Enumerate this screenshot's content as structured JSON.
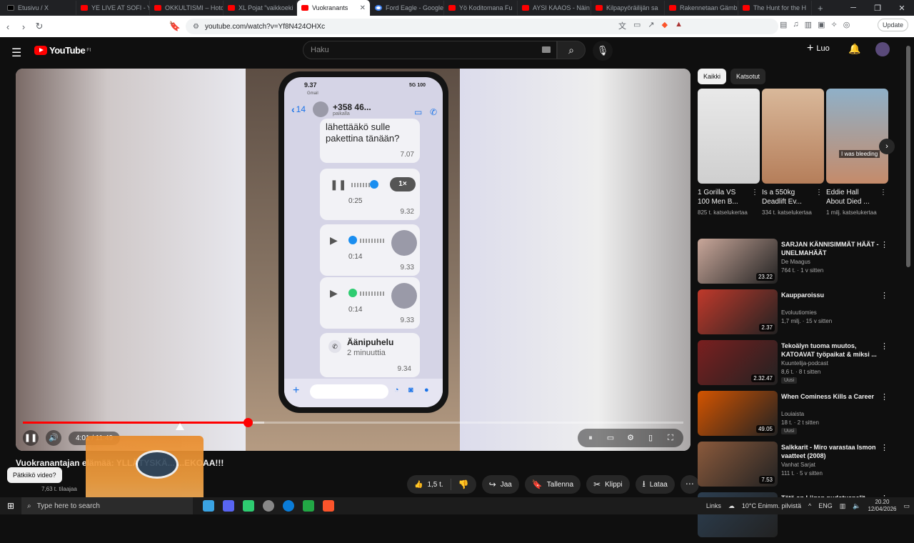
{
  "browser": {
    "tabs": [
      {
        "label": "Etusivu / X",
        "icon": "x-icon"
      },
      {
        "label": "YE LIVE AT SOFI - Yo",
        "icon": "youtube-icon"
      },
      {
        "label": "OKKULTISMI – Hoto",
        "icon": "youtube-icon"
      },
      {
        "label": "XL Pojat \"vaikkoeki",
        "icon": "youtube-icon"
      },
      {
        "label": "Vuokranants",
        "icon": "youtube-icon",
        "active": true
      },
      {
        "label": "Ford Eagle - Google",
        "icon": "google-icon"
      },
      {
        "label": "Yö Koditomana Fu",
        "icon": "youtube-icon"
      },
      {
        "label": "AYSI KAAOS - Näin",
        "icon": "youtube-icon"
      },
      {
        "label": "Kilpapyöräilijän sa",
        "icon": "youtube-icon"
      },
      {
        "label": "Rakennetaan Gämb",
        "icon": "youtube-icon"
      },
      {
        "label": "The Hunt for the H",
        "icon": "youtube-icon"
      }
    ],
    "url": "youtube.com/watch?v=Yf8N424OHXc",
    "update_label": "Update"
  },
  "youtube": {
    "logo_text": "YouTube",
    "region": "FI",
    "search_placeholder": "Haku",
    "create_label": "Luo"
  },
  "player": {
    "current_time": "4:01",
    "duration": "11:49",
    "time_display": "4:01 / 11:49",
    "progress": 0.34,
    "loaded": 0.365
  },
  "phone_screen": {
    "time": "9.37",
    "network": "5G",
    "battery": "100",
    "back_label": "Gmail",
    "back_count": "14",
    "contact": "+358 46...",
    "contact_status": "paikalla",
    "messages": [
      {
        "type": "text",
        "text": "lähettääkö sulle pakettina tänään?",
        "time": "7.07"
      },
      {
        "type": "voice",
        "duration": "0:25",
        "time": "9.32",
        "speed": "1×"
      },
      {
        "type": "voice",
        "duration": "0:14",
        "time": "9.33"
      },
      {
        "type": "voice",
        "duration": "0:14",
        "time": "9.33"
      },
      {
        "type": "call",
        "title": "Äänipuhelu",
        "subtitle": "2 minuuttia",
        "time": "9.34"
      }
    ]
  },
  "video": {
    "title": "Vuokranantajan elämää: YLLÄTYSKÄ... ...EKOAA!!!",
    "tooltip": "Pätkiikö video?",
    "channel_subs": "7,63 t. tilaajaa",
    "likes": "1,5 t.",
    "share": "Jaa",
    "save": "Tallenna",
    "clip": "Klippi",
    "download": "Lataa"
  },
  "sidebar": {
    "chips": [
      "Kaikki",
      "Katsotut"
    ],
    "shorts": [
      {
        "title": "1 Gorilla VS 100 Men B...",
        "views": "825 t. katselukertaa"
      },
      {
        "title": "Is a 550kg Deadlift Ev...",
        "views": "334 t. katselukertaa"
      },
      {
        "title": "Eddie Hall About Died ...",
        "views": "1 milj. katselukertaa",
        "overlay": "I was bleeding"
      }
    ],
    "recommendations": [
      {
        "title": "SARJAN KÄNNISIMMÄT HÄÄT - UNELMAHÄÄT",
        "channel": "De Maagus",
        "meta": "764 t. · 1 v sitten",
        "duration": "23.22",
        "thumb": "#c9a79a"
      },
      {
        "title": "Kaupparoissu",
        "channel": "Evoluutiomies",
        "meta": "1,7 milj. · 15 v sitten",
        "duration": "2.37",
        "thumb": "#c0392b"
      },
      {
        "title": "Tekoälyn tuoma muutos, KATOAVAT työpaikat & miksi ...",
        "channel": "Kuuntelija-podcast",
        "meta": "8,6 t. · 8 t sitten",
        "duration": "2.32.47",
        "badge": "Uusi",
        "thumb": "#7a1f1f"
      },
      {
        "title": "When Cominess Kills a Career",
        "channel": "Louiaista",
        "meta": "18 t. · 2 t sitten",
        "duration": "49.05",
        "badge": "Uusi",
        "thumb": "#d35400"
      },
      {
        "title": "Salkkarit - Miro varastaa Ismon vaatteet (2008)",
        "channel": "Vanhat Sarjat",
        "meta": "111 t. · 5 v sitten",
        "duration": "7.53",
        "thumb": "#8b5a3c"
      },
      {
        "title": "Tätä on Liigan pudotuspelit -",
        "channel": "",
        "meta": "",
        "duration": "",
        "thumb": "#2c3e50"
      }
    ]
  },
  "taskbar": {
    "search_placeholder": "Type here to search",
    "links": "Links",
    "weather": "10°C  Enimm. pilvistä",
    "lang": "ENG",
    "time": "20.20",
    "date": "12/04/2026"
  },
  "colors": {
    "youtube_red": "#ff0000",
    "bg": "#0f0f0f"
  }
}
